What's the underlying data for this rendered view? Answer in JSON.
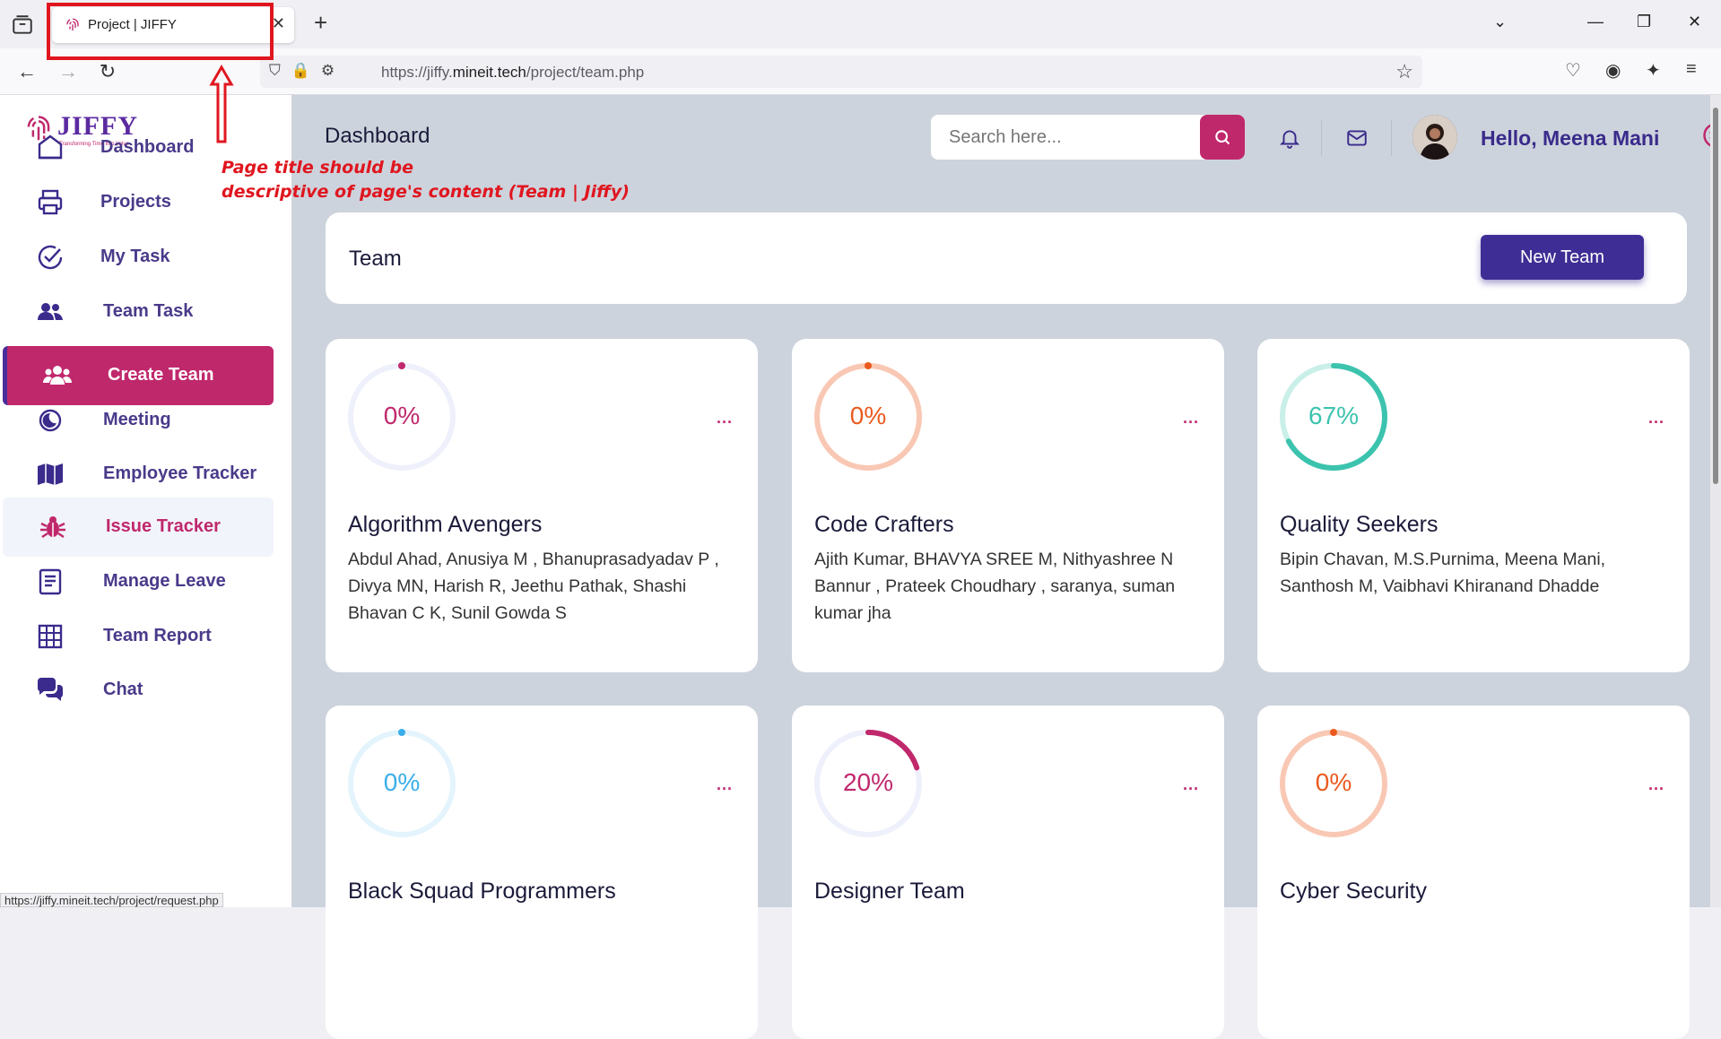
{
  "browser": {
    "tab_title": "Project | JIFFY",
    "url_prefix": "https://jiffy.",
    "url_domain": "mineit.tech",
    "url_path": "/project/team.php",
    "status_url": "https://jiffy.mineit.tech/project/request.php"
  },
  "annotation": {
    "line1": "Page title should be",
    "line2": "descriptive of page's content  (Team | Jiffy)"
  },
  "sidebar": {
    "logo": "JIFFY",
    "logo_tagline": "Transforming Time Into Value",
    "items": [
      {
        "label": "Dashboard",
        "icon": "home-icon"
      },
      {
        "label": "Projects",
        "icon": "printer-icon"
      },
      {
        "label": "My Task",
        "icon": "check-circle-icon"
      },
      {
        "label": "Team Task",
        "icon": "users-icon"
      },
      {
        "label": "Create Team",
        "icon": "group-icon"
      },
      {
        "label": "Meeting",
        "icon": "moon-circle-icon"
      },
      {
        "label": "Employee Tracker",
        "icon": "map-icon"
      },
      {
        "label": "Issue Tracker",
        "icon": "bug-icon"
      },
      {
        "label": "Manage Leave",
        "icon": "document-icon"
      },
      {
        "label": "Team Report",
        "icon": "grid-icon"
      },
      {
        "label": "Chat",
        "icon": "chat-icon"
      }
    ],
    "active_index": 4,
    "hover_index": 7
  },
  "header": {
    "title": "Dashboard",
    "search_placeholder": "Search here...",
    "greeting": "Hello, Meena Mani"
  },
  "team_bar": {
    "title": "Team",
    "new_team_label": "New Team"
  },
  "teams": [
    {
      "name": "Algorithm Avengers",
      "percent_label": "0%",
      "progress": 0,
      "color": "#c0286c",
      "track": "#eef0fb",
      "members": "Abdul Ahad, Anusiya M , Bhanuprasadyadav P , Divya MN, Harish R, Jeethu Pathak, Shashi Bhavan C K, Sunil Gowda S"
    },
    {
      "name": "Code Crafters",
      "percent_label": "0%",
      "progress": 0,
      "color": "#ea5a1e",
      "track": "#f9c8b4",
      "members": "Ajith Kumar, BHAVYA SREE M, Nithyashree N Bannur , Prateek Choudhary , saranya, suman kumar jha"
    },
    {
      "name": "Quality Seekers",
      "percent_label": "67%",
      "progress": 0.67,
      "color": "#3cc3ae",
      "track": "#c9efe8",
      "members": "Bipin Chavan, M.S.Purnima, Meena Mani, Santhosh M, Vaibhavi Khiranand Dhadde"
    },
    {
      "name": "Black Squad Programmers",
      "percent_label": "0%",
      "progress": 0,
      "color": "#3aaee9",
      "track": "#e4f4fd",
      "members": ""
    },
    {
      "name": "Designer Team",
      "percent_label": "20%",
      "progress": 0.2,
      "color": "#c0286c",
      "track": "#eef0fb",
      "members": ""
    },
    {
      "name": "Cyber Security",
      "percent_label": "0%",
      "progress": 0,
      "color": "#ea5a1e",
      "track": "#f9c8b4",
      "members": ""
    }
  ],
  "menu_dots": "..."
}
